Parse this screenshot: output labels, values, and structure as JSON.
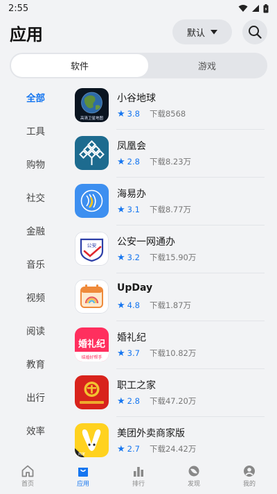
{
  "status": {
    "time": "2:55"
  },
  "header": {
    "title": "应用",
    "sort_label": "默认"
  },
  "tabs": [
    {
      "label": "软件",
      "active": true
    },
    {
      "label": "游戏",
      "active": false
    }
  ],
  "categories": [
    {
      "label": "全部",
      "active": true
    },
    {
      "label": "工具",
      "active": false
    },
    {
      "label": "购物",
      "active": false
    },
    {
      "label": "社交",
      "active": false
    },
    {
      "label": "金融",
      "active": false
    },
    {
      "label": "音乐",
      "active": false
    },
    {
      "label": "视频",
      "active": false
    },
    {
      "label": "阅读",
      "active": false
    },
    {
      "label": "教育",
      "active": false
    },
    {
      "label": "出行",
      "active": false
    },
    {
      "label": "效率",
      "active": false
    }
  ],
  "apps": [
    {
      "name": "小谷地球",
      "rating": "3.8",
      "downloads": "下载8568",
      "icon": "globe-app-icon",
      "banner": "高清卫星地图"
    },
    {
      "name": "凤凰会",
      "rating": "2.8",
      "downloads": "下载8.23万",
      "icon": "phoenix-club-icon"
    },
    {
      "name": "海易办",
      "rating": "3.1",
      "downloads": "下载8.77万",
      "icon": "hai-yi-ban-icon"
    },
    {
      "name": "公安一网通办",
      "rating": "3.2",
      "downloads": "下载15.90万",
      "icon": "police-service-icon",
      "badge": "公安"
    },
    {
      "name": "UpDay",
      "rating": "4.8",
      "downloads": "下载1.87万",
      "icon": "calendar-rainbow-icon"
    },
    {
      "name": "婚礼纪",
      "rating": "3.7",
      "downloads": "下载10.82万",
      "icon": "wedding-app-icon",
      "logo_text": "婚礼纪",
      "tagline": "结婚好帮手"
    },
    {
      "name": "职工之家",
      "rating": "2.8",
      "downloads": "下载47.20万",
      "icon": "union-emblem-icon"
    },
    {
      "name": "美团外卖商家版",
      "rating": "2.7",
      "downloads": "下载24.42万",
      "icon": "meituan-merchant-icon",
      "badge": "商家"
    }
  ],
  "nav": [
    {
      "label": "首页",
      "icon": "home-icon",
      "active": false
    },
    {
      "label": "应用",
      "icon": "bag-icon",
      "active": true
    },
    {
      "label": "排行",
      "icon": "ranking-icon",
      "active": false
    },
    {
      "label": "发现",
      "icon": "discover-icon",
      "active": false
    },
    {
      "label": "我的",
      "icon": "profile-icon",
      "active": false
    }
  ],
  "colors": {
    "accent": "#1676f0",
    "background": "#f2f3f5",
    "pill": "#e3e5e9"
  }
}
